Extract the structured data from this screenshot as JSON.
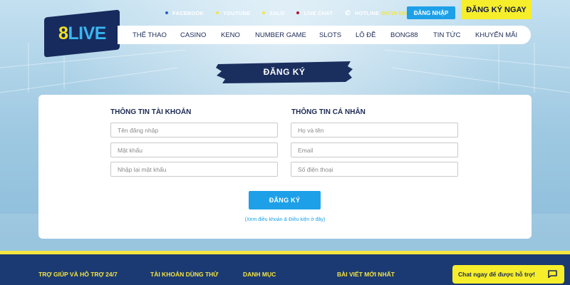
{
  "topbar": {
    "socials": [
      {
        "label": "FACEBOOK",
        "color": "#2b5ecf",
        "icon": "facebook-icon"
      },
      {
        "label": "YOUTUBE",
        "color": "#f4e542",
        "icon": "youtube-icon"
      },
      {
        "label": "ZALO",
        "color": "#f4e542",
        "icon": "zalo-icon"
      },
      {
        "label": "LIVE CHAT",
        "color": "#b0182c",
        "icon": "live-chat-icon"
      }
    ],
    "hotline_label": "HOTLINE",
    "hotline_number": "09719 68888",
    "login_label": "ĐĂNG NHẬP",
    "register_label": "ĐĂNG KÝ NGAY"
  },
  "logo": {
    "part1": "8",
    "part2": "LIVE"
  },
  "nav": {
    "items": [
      "THỂ THAO",
      "CASINO",
      "KENO",
      "NUMBER GAME",
      "SLOTS",
      "LÔ ĐỀ",
      "BONG88",
      "TIN TỨC",
      "KHUYẾN MÃI"
    ]
  },
  "page_title": "ĐĂNG KÝ",
  "form": {
    "account_title": "THÔNG TIN TÀI KHOẢN",
    "personal_title": "THÔNG TIN CÁ NHÂN",
    "username_placeholder": "Tên đăng nhập",
    "password_placeholder": "Mật khẩu",
    "confirm_password_placeholder": "Nhập lại mật khẩu",
    "fullname_placeholder": "Họ và tên",
    "email_placeholder": "Email",
    "phone_placeholder": "Số điện thoại",
    "submit_label": "ĐĂNG KÝ",
    "terms_text": "(Xem điều khoản & Điều kiện ở đây)"
  },
  "footer": {
    "columns": [
      "TRỢ GIÚP VÀ HỖ TRỢ 24/7",
      "TÀI KHOẢN DÙNG THỬ",
      "DANH MỤC",
      "BÀI VIẾT MỚI NHẤT"
    ]
  },
  "chat": {
    "label": "Chat ngay để được hỗ trợ!"
  },
  "colors": {
    "brand_navy": "#1b2a55",
    "brand_yellow": "#f6ee2a",
    "brand_blue": "#1ea0e8",
    "footer_bg": "#1b3a73"
  }
}
